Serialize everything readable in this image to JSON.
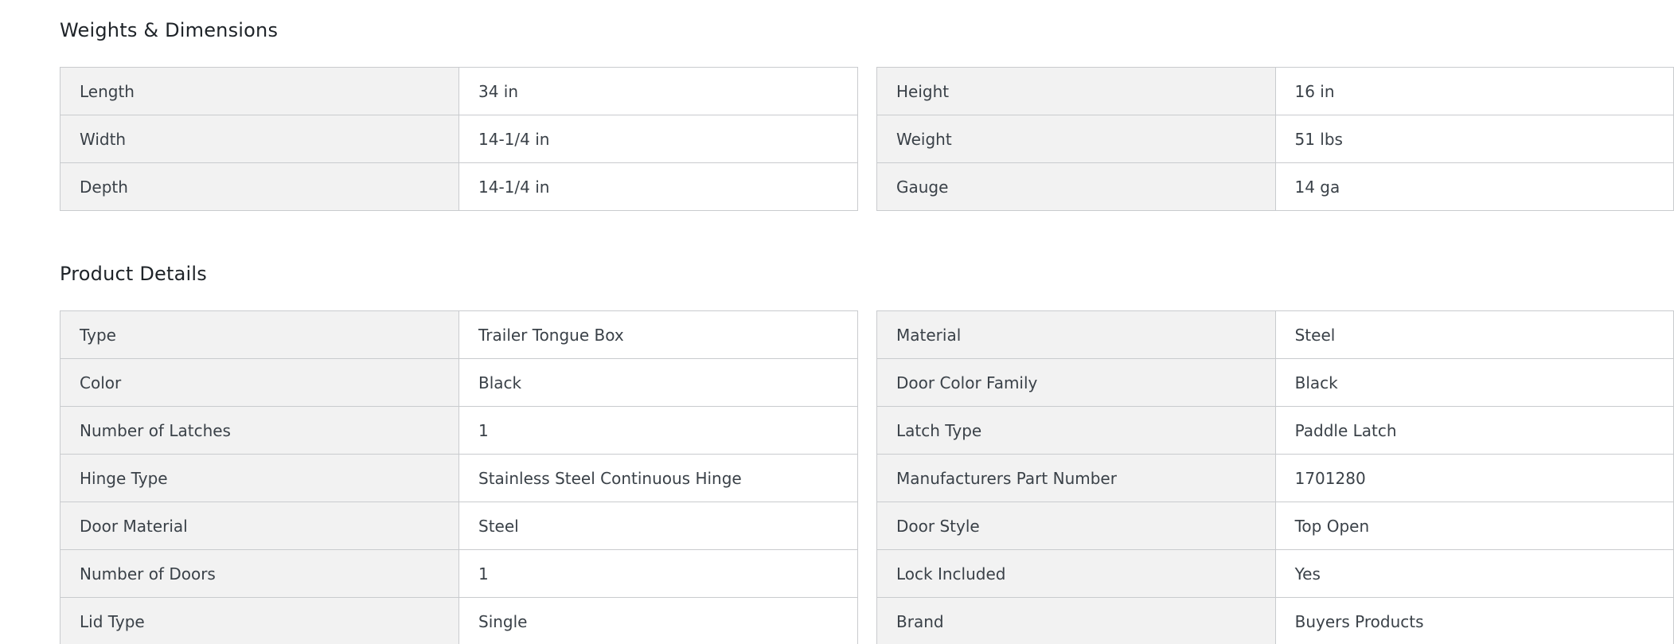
{
  "weights_dimensions": {
    "title": "Weights & Dimensions",
    "left": [
      {
        "label": "Length",
        "value": "34 in"
      },
      {
        "label": "Width",
        "value": "14-1/4 in"
      },
      {
        "label": "Depth",
        "value": "14-1/4 in"
      }
    ],
    "right": [
      {
        "label": "Height",
        "value": "16 in"
      },
      {
        "label": "Weight",
        "value": "51 lbs"
      },
      {
        "label": "Gauge",
        "value": "14 ga"
      }
    ]
  },
  "product_details": {
    "title": "Product Details",
    "left": [
      {
        "label": "Type",
        "value": "Trailer Tongue Box"
      },
      {
        "label": "Color",
        "value": "Black"
      },
      {
        "label": "Number of Latches",
        "value": "1"
      },
      {
        "label": "Hinge Type",
        "value": "Stainless Steel Continuous Hinge"
      },
      {
        "label": "Door Material",
        "value": "Steel"
      },
      {
        "label": "Number of Doors",
        "value": "1"
      },
      {
        "label": "Lid Type",
        "value": "Single"
      }
    ],
    "right": [
      {
        "label": "Material",
        "value": "Steel"
      },
      {
        "label": "Door Color Family",
        "value": "Black"
      },
      {
        "label": "Latch Type",
        "value": "Paddle Latch"
      },
      {
        "label": "Manufacturers Part Number",
        "value": "1701280"
      },
      {
        "label": "Door Style",
        "value": "Top Open"
      },
      {
        "label": "Lock Included",
        "value": "Yes"
      },
      {
        "label": "Brand",
        "value": "Buyers Products"
      }
    ]
  }
}
